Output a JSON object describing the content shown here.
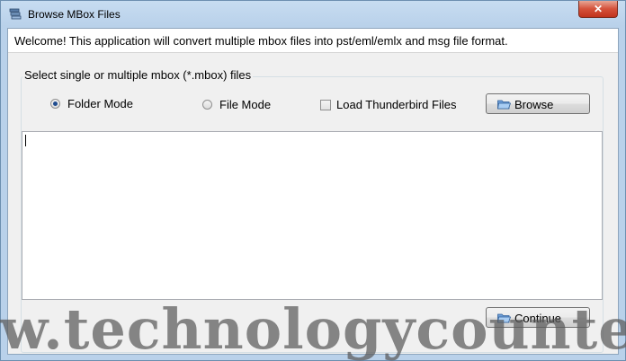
{
  "window": {
    "title": "Browse MBox Files",
    "close_label": "✕"
  },
  "welcome": {
    "text": "Welcome! This application will convert multiple mbox files into pst/eml/emlx and msg file format."
  },
  "group": {
    "legend": "Select single or multiple mbox (*.mbox) files",
    "folder_mode_label": "Folder Mode",
    "folder_mode_selected": true,
    "file_mode_label": "File Mode",
    "file_mode_selected": false,
    "thunderbird_label": "Load Thunderbird Files",
    "thunderbird_checked": false,
    "browse_label": "Browse",
    "continue_label": "Continue"
  },
  "watermark": {
    "text": "w.technologycounter.c"
  },
  "colors": {
    "accent": "#1f4c8f",
    "close_red": "#c1331d",
    "frame": "#b9d1ea"
  }
}
